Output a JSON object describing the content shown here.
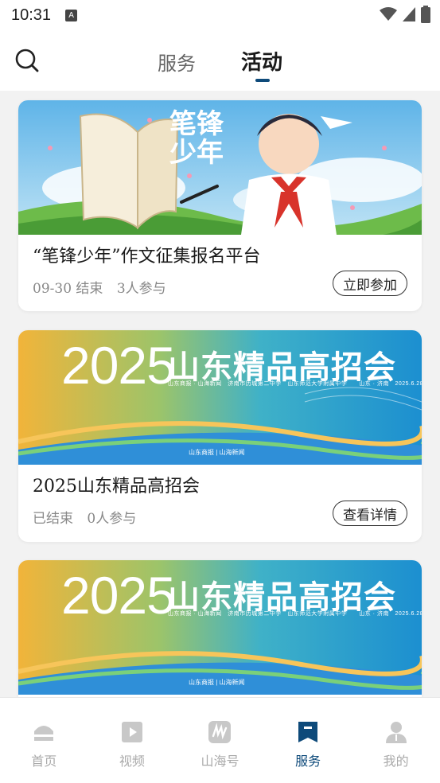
{
  "status_bar": {
    "time": "10:31",
    "notif": "A"
  },
  "header": {
    "tabs": [
      {
        "label": "服务",
        "active": false
      },
      {
        "label": "活动",
        "active": true
      }
    ]
  },
  "cards": [
    {
      "title": "“笔锋少年”作文征集报名平台",
      "end": "09-30 结束",
      "participants": "3人参与",
      "button": "立即参加",
      "banner": {
        "text": "笔锋少年"
      }
    },
    {
      "title": "2025山东精品高招会",
      "end": "已结束",
      "participants": "0人参与",
      "button": "查看详情",
      "banner": {
        "year": "2025",
        "title": "山东精品高招会",
        "small": "山东商报 · 山海新闻　济南市历城第二中学　山东师范大学附属中学　　山东 · 济南　2025.6.28",
        "logos": "山东商报 | 山海新闻"
      }
    },
    {
      "banner": {
        "year": "2025",
        "title": "山东精品高招会",
        "small": "山东商报 · 山海新闻　济南市历城第二中学　山东师范大学附属中学　　山东 · 济南　2025.6.28",
        "logos": "山东商报 | 山海新闻"
      }
    }
  ],
  "bottom_nav": [
    {
      "label": "首页",
      "icon": "home-icon",
      "active": false
    },
    {
      "label": "视频",
      "icon": "video-icon",
      "active": false
    },
    {
      "label": "山海号",
      "icon": "shanhai-icon",
      "active": false
    },
    {
      "label": "服务",
      "icon": "bookmark-icon",
      "active": true
    },
    {
      "label": "我的",
      "icon": "profile-icon",
      "active": false
    }
  ],
  "colors": {
    "accent": "#0e4a7a",
    "inactive": "#aaaaaa"
  }
}
